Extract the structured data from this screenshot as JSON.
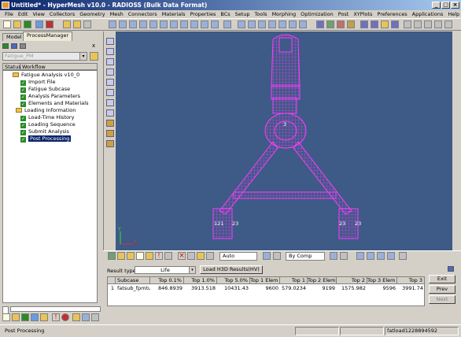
{
  "window": {
    "title": "Untitled* - HyperMesh v10.0 - RADIOSS (Bulk Data Format)"
  },
  "menu": [
    "File",
    "Edit",
    "View",
    "Collectors",
    "Geometry",
    "Mesh",
    "Connectors",
    "Materials",
    "Properties",
    "BCs",
    "Setup",
    "Tools",
    "Morphing",
    "Optimization",
    "Post",
    "XYPlots",
    "Preferences",
    "Applications",
    "Help"
  ],
  "left_panel": {
    "tabs": [
      "Model",
      "ProcessManager"
    ],
    "close": "x",
    "template": "Fatigue_PM",
    "columns": {
      "status": "Status",
      "workflow": "Workflow"
    },
    "tree": [
      {
        "label": "Fatigue Analysis v10_0",
        "kind": "folder"
      },
      {
        "label": "Import File",
        "kind": "check"
      },
      {
        "label": "Fatigue Subcase",
        "kind": "check"
      },
      {
        "label": "Analysis Parameters",
        "kind": "check"
      },
      {
        "label": "Elements and Materials",
        "kind": "check"
      },
      {
        "label": "Loading Information",
        "kind": "folder"
      },
      {
        "label": "Load-Time History",
        "kind": "check"
      },
      {
        "label": "Loading Sequence",
        "kind": "check"
      },
      {
        "label": "Submit Analysis",
        "kind": "check"
      },
      {
        "label": "Post Processing",
        "kind": "selected"
      }
    ]
  },
  "viewport": {
    "node_labels": {
      "center": "3",
      "bl_left": "121",
      "bl_right": "23",
      "br_left": "23",
      "br_right": "23"
    },
    "axes": {
      "x": "X",
      "y": "Y"
    },
    "mesh_color": "#ff3aff",
    "bg_color": "#3e5a86"
  },
  "bottom_toolbar": {
    "vis_mode": "Auto",
    "color_mode": "By Comp"
  },
  "results": {
    "result_type_label": "Result type:",
    "result_type": "Life",
    "load_button": "Load H3D Results(HV)",
    "columns": [
      "",
      "Subcase",
      "Top 0.1%",
      "Top 1.0%",
      "Top 5.0%",
      "Top 1 Elem",
      "Top 1",
      "Top 2 Elem",
      "Top 2",
      "Top 3 Elem",
      "Top 3"
    ],
    "rows": [
      [
        "1",
        "fatsub_fpmtut",
        "846.8939",
        "3913.518",
        "10431.43",
        "9600",
        "579.0234",
        "9199",
        "1575.982",
        "9596",
        "3991.74"
      ]
    ],
    "buttons": {
      "exit": "Exit",
      "prev": "Prev",
      "next": "Next"
    }
  },
  "status": {
    "left": "Post Processing",
    "right": "fatload1228894592"
  }
}
